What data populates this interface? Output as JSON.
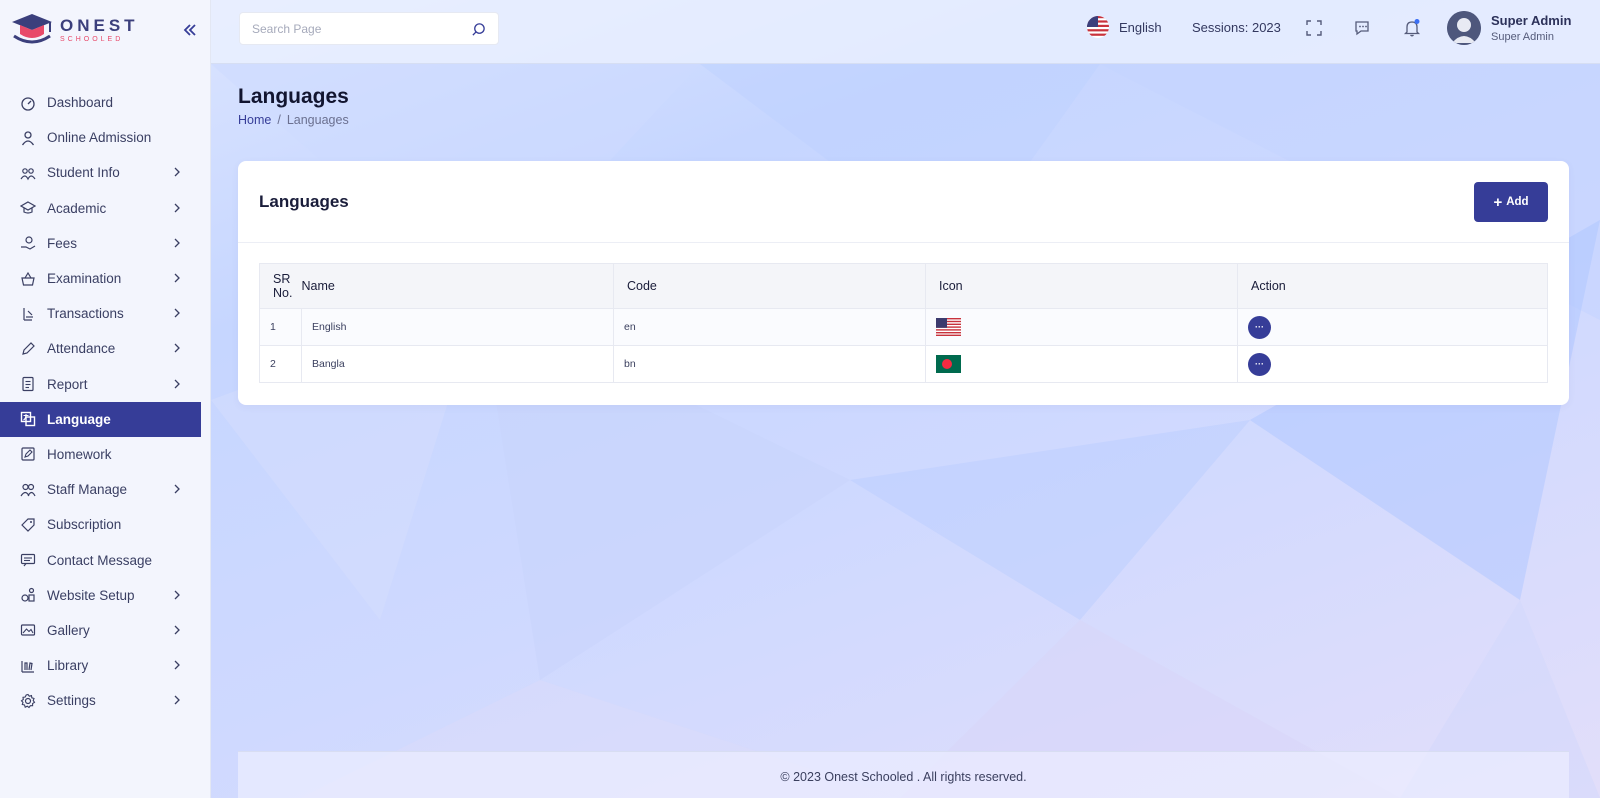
{
  "brand": {
    "name": "ONEST",
    "sub": "SCHOOLED"
  },
  "search": {
    "placeholder": "Search Page"
  },
  "header": {
    "language": "English",
    "session": "Sessions: 2023",
    "user_name": "Super Admin",
    "user_role": "Super Admin"
  },
  "sidebar": {
    "items": [
      {
        "label": "Dashboard",
        "icon": "dashboard-icon",
        "submenu": false,
        "active": false
      },
      {
        "label": "Online Admission",
        "icon": "user-icon",
        "submenu": false,
        "active": false
      },
      {
        "label": "Student Info",
        "icon": "students-icon",
        "submenu": true,
        "active": false
      },
      {
        "label": "Academic",
        "icon": "graduation-cap-icon",
        "submenu": true,
        "active": false
      },
      {
        "label": "Fees",
        "icon": "hand-money-icon",
        "submenu": true,
        "active": false
      },
      {
        "label": "Examination",
        "icon": "exam-basket-icon",
        "submenu": true,
        "active": false
      },
      {
        "label": "Transactions",
        "icon": "transaction-icon",
        "submenu": true,
        "active": false
      },
      {
        "label": "Attendance",
        "icon": "pen-icon",
        "submenu": true,
        "active": false
      },
      {
        "label": "Report",
        "icon": "document-icon",
        "submenu": true,
        "active": false
      },
      {
        "label": "Language",
        "icon": "language-icon",
        "submenu": false,
        "active": true
      },
      {
        "label": "Homework",
        "icon": "edit-box-icon",
        "submenu": false,
        "active": false
      },
      {
        "label": "Staff Manage",
        "icon": "staff-icon",
        "submenu": true,
        "active": false
      },
      {
        "label": "Subscription",
        "icon": "tag-icon",
        "submenu": false,
        "active": false
      },
      {
        "label": "Contact Message",
        "icon": "message-icon",
        "submenu": false,
        "active": false
      },
      {
        "label": "Website Setup",
        "icon": "website-icon",
        "submenu": true,
        "active": false
      },
      {
        "label": "Gallery",
        "icon": "gallery-icon",
        "submenu": true,
        "active": false
      },
      {
        "label": "Library",
        "icon": "library-icon",
        "submenu": true,
        "active": false
      },
      {
        "label": "Settings",
        "icon": "gear-icon",
        "submenu": true,
        "active": false
      }
    ]
  },
  "page": {
    "title": "Languages",
    "breadcrumb_home": "Home",
    "breadcrumb_sep": "/",
    "breadcrumb_current": "Languages"
  },
  "card": {
    "title": "Languages",
    "add_label": "Add",
    "columns": [
      "SR No.",
      "Name",
      "Code",
      "Icon",
      "Action"
    ],
    "rows": [
      {
        "sr": "1",
        "name": "English",
        "code": "en",
        "flag": "us-flag-icon"
      },
      {
        "sr": "2",
        "name": "Bangla",
        "code": "bn",
        "flag": "bd-flag-icon"
      }
    ],
    "action_label": "···"
  },
  "footer": {
    "text": "© 2023 Onest Schooled . All rights reserved."
  },
  "colors": {
    "primary": "#363d98",
    "accent": "#e84a6a"
  }
}
